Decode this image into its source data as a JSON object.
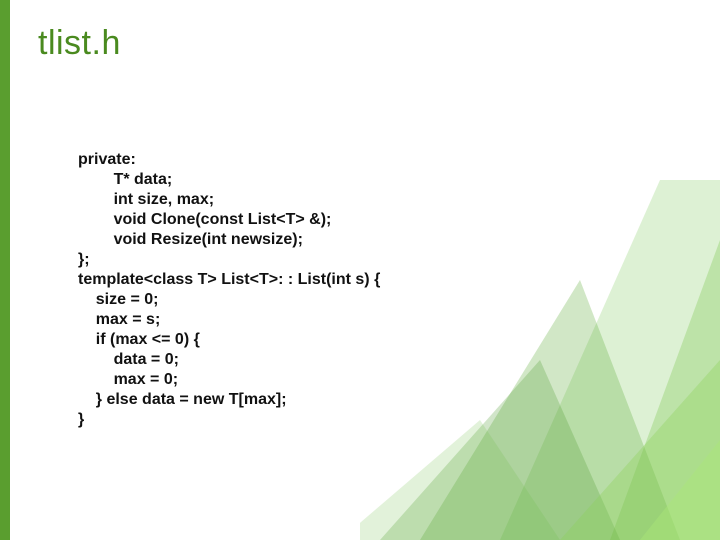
{
  "title": "tlist.h",
  "code_lines": [
    "private:",
    "        T* data;",
    "        int size, max;",
    "        void Clone(const List<T> &);",
    "        void Resize(int newsize);",
    "};",
    "template<class T> List<T>: : List(int s) {",
    "    size = 0;",
    "    max = s;",
    "    if (max <= 0) {",
    "        data = 0;",
    "        max = 0;",
    "    } else data = new T[max];",
    "}"
  ],
  "colors": {
    "accent": "#5a9e2f",
    "title": "#4a8a1f"
  }
}
